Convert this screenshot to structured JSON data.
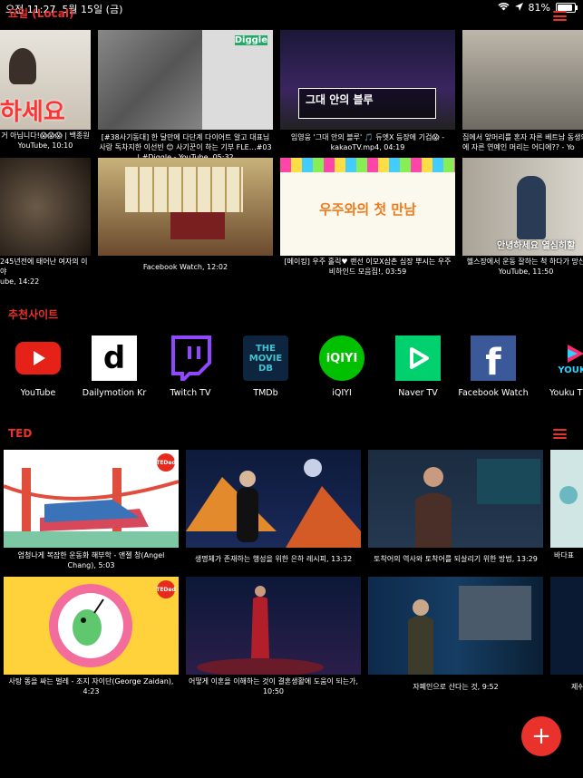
{
  "status_bar": {
    "time": "오전 11:27",
    "date": "5월 15일 (금)",
    "battery": "81%",
    "battery_level": 0.81
  },
  "top_section": {
    "title": "요일 (Local)",
    "row1": [
      {
        "caption": "거 아닙니다!😱😱😱 | 백종원\nYouTube, 10:10",
        "overlay": "하세요"
      },
      {
        "caption": "[#38사기동대] 한 달만에 다단계 다이어트 알고 대표님 사랑 독차지한 이선빈 😊 사기꾼이 하는 기부 FLE…#03 | #Diggle - YouTube, 05:32",
        "overlay": "Diggle"
      },
      {
        "caption": "임영웅 '그대 안의 블루' 🎵 듀엣X 등장에 기겁😱 - kakaoTV.mp4, 04:19",
        "overlay": "그대 안의 블루"
      },
      {
        "caption": "집에서 앞머리를 혼자 자른 베트남 동생의 에 자른 연예인 머리는 어디에?? - Yo",
        "overlay": ""
      }
    ],
    "row2": [
      {
        "caption": "245년전에 태어난 여자의 이야\nube, 14:22",
        "overlay": ""
      },
      {
        "caption": "Facebook Watch, 12:02",
        "overlay": ""
      },
      {
        "caption": "[메이킹] 우주 홀릭♥ 랜선 이모X삼촌 심장 뿌시는 우주 비하인드 모음집!, 03:59",
        "overlay": "우주와의 첫 만남"
      },
      {
        "caption": "헬스장에서 운동 잘하는 척 하다가 망신\nYouTube, 11:50",
        "overlay": "안녕하세요 열심히할"
      }
    ]
  },
  "recommended": {
    "title": "추천사이트",
    "sites": [
      {
        "name": "YouTube",
        "icon": "youtube-icon"
      },
      {
        "name": "Dailymotion Kr",
        "icon": "dailymotion-icon"
      },
      {
        "name": "Twitch TV",
        "icon": "twitch-icon"
      },
      {
        "name": "TMDb",
        "icon": "tmdb-icon",
        "logo_text": "THE MOVIE DB"
      },
      {
        "name": "iQIYI",
        "icon": "iqiyi-icon",
        "logo_text": "iQIYI"
      },
      {
        "name": "Naver TV",
        "icon": "naver-tv-icon"
      },
      {
        "name": "Facebook Watch",
        "icon": "facebook-icon"
      },
      {
        "name": "Youku T",
        "icon": "youku-icon",
        "logo_text": "YOUKU"
      }
    ]
  },
  "ted": {
    "title": "TED",
    "badge": "TEDed",
    "row1": [
      {
        "caption": "엄청나게 복잡한 운동화 해부학 - 앤젤 창(Angel Chang), 5:03"
      },
      {
        "caption": "생명체가 존재하는 행성을 위한 은하 레시피, 13:32"
      },
      {
        "caption": "토착어의 역사와 토착어를 되살리기 위한 방법, 13:29"
      },
      {
        "caption": "바다표"
      }
    ],
    "row2": [
      {
        "caption": "사탕 똥을 싸는 벌레 - 조지 자이단(George Zaidan), 4:23"
      },
      {
        "caption": "어떻게 이혼을 이해하는 것이 결혼생활에 도움이 되는가, 10:50"
      },
      {
        "caption": "자폐인으로 산다는 것, 9:52"
      },
      {
        "caption": "제쉬"
      }
    ]
  },
  "colors": {
    "accent": "#e8322b",
    "background": "#000000"
  },
  "fab": {
    "label": "+"
  }
}
